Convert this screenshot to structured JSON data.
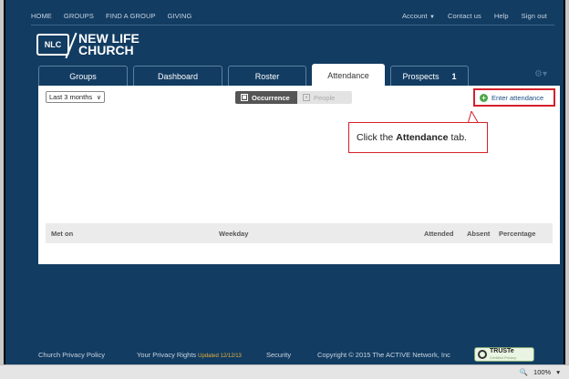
{
  "topnav": {
    "left": [
      "HOME",
      "GROUPS",
      "FIND A GROUP",
      "GIVING"
    ],
    "account": "Account",
    "contact": "Contact us",
    "help": "Help",
    "signout": "Sign out"
  },
  "logo": {
    "badge": "NLC",
    "line1": "NEW LIFE",
    "line2": "CHURCH"
  },
  "tabs": [
    {
      "label": "Groups"
    },
    {
      "label": "Dashboard"
    },
    {
      "label": "Roster"
    },
    {
      "label": "Attendance"
    },
    {
      "label": "Prospects",
      "count": "1"
    }
  ],
  "filter": {
    "range": "Last 3 months"
  },
  "view_toggle": {
    "occurrence": "Occurrence",
    "people": "People"
  },
  "enter_attendance": "Enter attendance",
  "callout": {
    "pre": "Click the",
    "bold": "Attendance",
    "post": "tab."
  },
  "table": {
    "columns": [
      "Met on",
      "Weekday",
      "Attended",
      "Absent",
      "Percentage"
    ]
  },
  "footer": {
    "privacy": "Church Privacy Policy",
    "rights": "Your Privacy Rights",
    "updated": "Updated 12/12/13",
    "security": "Security",
    "copyright": "Copyright © 2015 The ACTIVE Network, Inc",
    "truste": "TRUSTe",
    "truste_sub": "Certified Privacy"
  },
  "status": {
    "zoom": "100%"
  }
}
